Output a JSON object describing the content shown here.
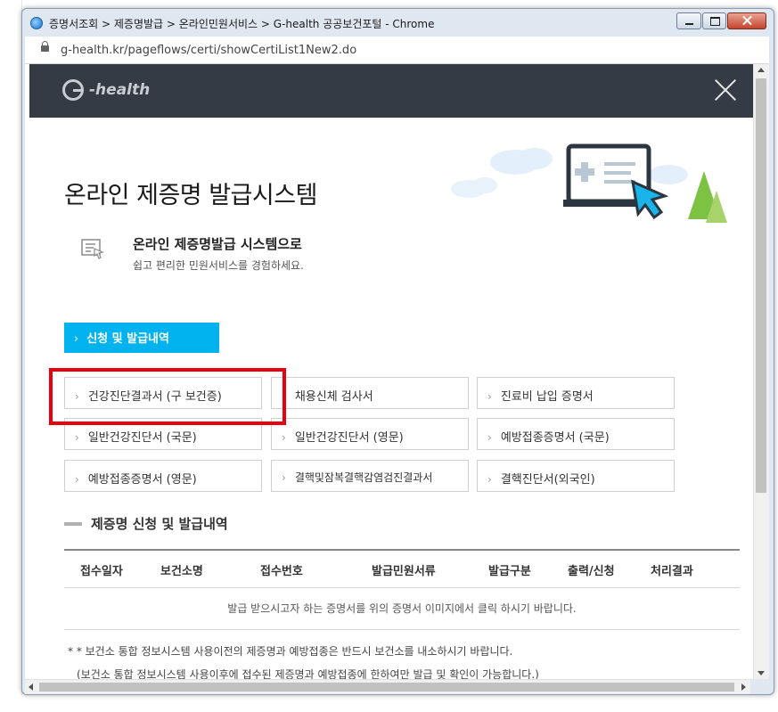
{
  "window": {
    "title": "증명서조회 > 제증명발급 > 온라인민원서비스 > G-health 공공보건포털 - Chrome",
    "url": "g-health.kr/pageflows/certi/showCertiList1New2.do"
  },
  "header": {
    "logo_text": "-health"
  },
  "page": {
    "title": "온라인 제증명 발급시스템",
    "intro_title": "온라인 제증명발급 시스템으로",
    "intro_subtitle": "쉽고 편리한 민원서비스를 경험하세요."
  },
  "tab": {
    "chevron": "›",
    "label": "신청 및 발급내역"
  },
  "certificates": [
    {
      "label": "건강진단결과서 (구 보건증)"
    },
    {
      "label": "채용신체 검사서"
    },
    {
      "label": "진료비 납입 증명서"
    },
    {
      "label": "일반건강진단서 (국문)"
    },
    {
      "label": "일반건강진단서 (영문)"
    },
    {
      "label": "예방접종증명서 (국문)"
    },
    {
      "label": "예방접종증명서 (영문)"
    },
    {
      "label": "결핵및잠복결핵감염검진결과서"
    },
    {
      "label": "결핵진단서(외국인)"
    }
  ],
  "history": {
    "title": "제증명 신청 및 발급내역",
    "columns": [
      "접수일자",
      "보건소명",
      "접수번호",
      "발급민원서류",
      "발급구분",
      "출력/신청",
      "처리결과"
    ],
    "empty_message": "발급 받으시고자 하는 증명서를 위의 증명서 이미지에서 클릭 하시기 바랍니다."
  },
  "notes": {
    "line1": "* * 보건소 통합 정보시스템 사용이전의 제증명과 예방접종은 반드시 보건소를 내소하시기 바랍니다.",
    "line2": "(보건소 통합 정보시스템 사용이후에 접수된 제증명과 예방접종에 한하여만 발급 및 확인이 가능합니다.)"
  },
  "colors": {
    "header_bg": "#353b45",
    "tab_bg": "#00b3ee",
    "highlight": "#e8000d"
  }
}
